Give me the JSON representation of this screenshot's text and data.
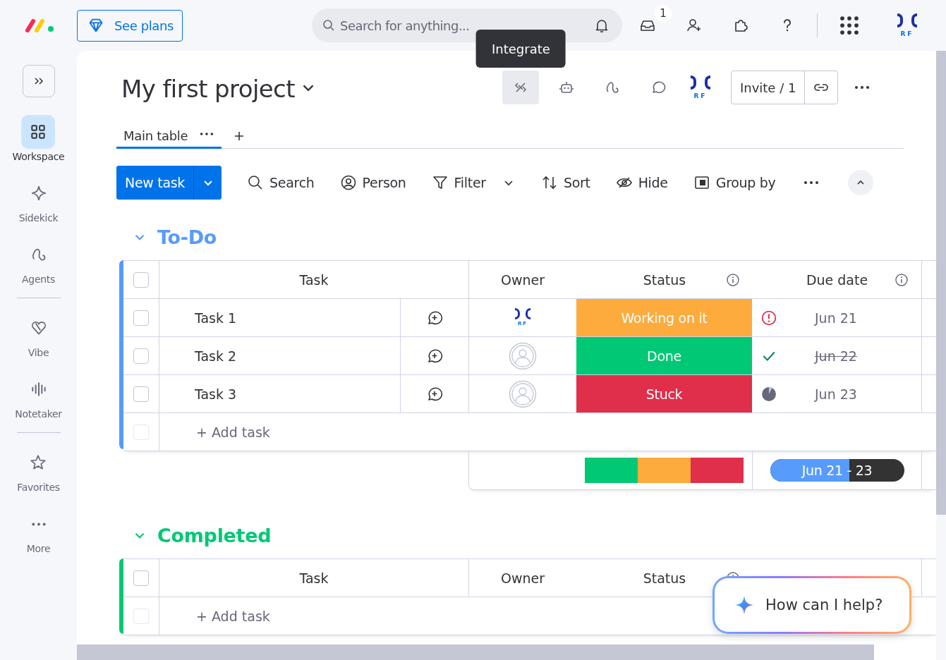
{
  "topbar": {
    "plans_button": "See plans",
    "search": {
      "placeholder": "Search for anything..."
    },
    "inbox_badge": "1",
    "avatar_text": "RF"
  },
  "tooltip": "Integrate",
  "sidebar": {
    "sections": [
      {
        "items": [
          {
            "label": "Workspace",
            "kind": "grid",
            "selected": true
          },
          {
            "label": "Sidekick",
            "kind": "sparkle",
            "selected": false
          },
          {
            "label": "Agents",
            "kind": "loop",
            "selected": false
          }
        ]
      },
      {
        "items": [
          {
            "label": "Vibe",
            "kind": "heart",
            "selected": false
          },
          {
            "label": "Notetaker",
            "kind": "wave",
            "selected": false
          }
        ]
      },
      {
        "items": [
          {
            "label": "Favorites",
            "kind": "star",
            "selected": false
          },
          {
            "label": "More",
            "kind": "dots",
            "selected": false
          }
        ]
      }
    ]
  },
  "board": {
    "title": "My first project",
    "invite": "Invite / 1",
    "avatar_text": "RF",
    "views": [
      {
        "label": "Main table",
        "selected": true
      }
    ]
  },
  "toolbar": {
    "new_task": "New task",
    "actions": [
      {
        "label": "Search",
        "kind": "search",
        "dropdown": false
      },
      {
        "label": "Person",
        "kind": "person",
        "dropdown": false
      },
      {
        "label": "Filter",
        "kind": "filter",
        "dropdown": true
      },
      {
        "label": "Sort",
        "kind": "sort",
        "dropdown": false
      },
      {
        "label": "Hide",
        "kind": "eye",
        "dropdown": false
      },
      {
        "label": "Group by",
        "kind": "group",
        "dropdown": false
      }
    ]
  },
  "groups": [
    {
      "title": "To-Do",
      "color": "#579bfc",
      "expanded": true,
      "select_all_checked": false,
      "columns": [
        {
          "label": "Task",
          "info": false
        },
        {
          "label": "Owner",
          "info": false
        },
        {
          "label": "Status",
          "info": true
        },
        {
          "label": "Due date",
          "info": true
        }
      ],
      "rows": [
        {
          "task": "Task 1",
          "checked": false,
          "owner": {
            "kind": "logo",
            "text": "RF"
          },
          "status": "Working on it",
          "color": "#fdab3d",
          "due": {
            "kind": "overdue",
            "date": "Jun 21",
            "struck": false
          }
        },
        {
          "task": "Task 2",
          "checked": false,
          "owner": {
            "kind": "empty"
          },
          "status": "Done",
          "color": "#00c875",
          "due": {
            "kind": "done",
            "date": "Jun 22",
            "struck": true
          }
        },
        {
          "task": "Task 3",
          "checked": false,
          "owner": {
            "kind": "empty"
          },
          "status": "Stuck",
          "color": "#df2f4a",
          "due": {
            "kind": "pending",
            "date": "Jun 23",
            "struck": false
          }
        }
      ],
      "add_row": {
        "label": "+ Add task",
        "checked": false
      },
      "summary": {
        "segments": [
          {
            "color": "#00c875"
          },
          {
            "color": "#fdab3d"
          },
          {
            "color": "#df2f4a"
          }
        ],
        "timeline": "Jun 21 - 23",
        "level": 0.59
      }
    },
    {
      "title": "Completed",
      "color": "#00c875",
      "expanded": true,
      "select_all_checked": false,
      "columns": [
        {
          "label": "Task",
          "info": false
        },
        {
          "label": "Owner",
          "info": false
        },
        {
          "label": "Status",
          "info": true
        }
      ],
      "add_row": {
        "label": "+ Add task",
        "checked": false
      }
    }
  ],
  "assistant": {
    "prompt": "How can I help?"
  }
}
